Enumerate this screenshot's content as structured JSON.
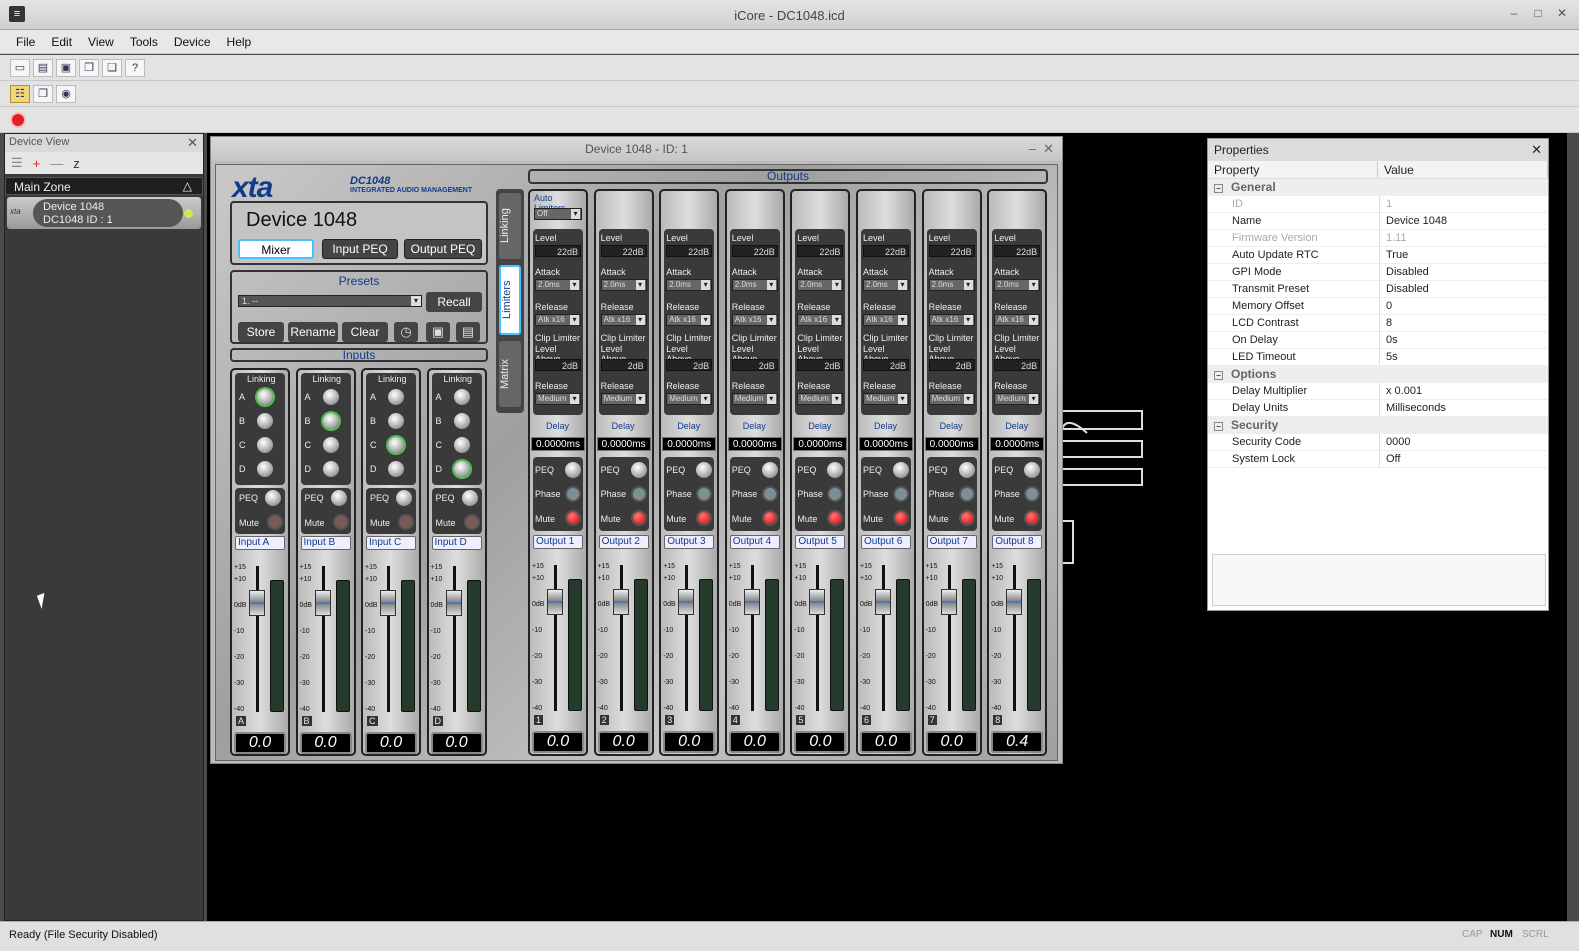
{
  "window": {
    "title": "iCore - DC1048.icd",
    "min": "‒",
    "max": "□",
    "close": "✕"
  },
  "menu": [
    "File",
    "Edit",
    "View",
    "Tools",
    "Device",
    "Help"
  ],
  "device_view": {
    "title": "Device View",
    "zone": "Main Zone",
    "device_line1": "Device  1048",
    "device_line2": "DC1048   ID : 1",
    "logo": "xta"
  },
  "device_window": {
    "title": "Device  1048 - ID: 1",
    "logo": "xta",
    "model": "DC1048",
    "subtitle": "INTEGRATED AUDIO MANAGEMENT",
    "device_name": "Device  1048",
    "tabs": [
      "Mixer",
      "Input PEQ",
      "Output PEQ"
    ],
    "presets_title": "Presets",
    "preset_value": "1. --",
    "recall": "Recall",
    "store": "Store",
    "rename": "Rename",
    "clear": "Clear",
    "inputs_title": "Inputs",
    "outputs_title": "Outputs",
    "side_tabs": [
      "Linking",
      "Limiters",
      "Matrix"
    ],
    "labels": {
      "linking": "Linking",
      "peq": "PEQ",
      "mute": "Mute",
      "phase": "Phase",
      "auto_limiters": "Auto Limiters",
      "level": "Level",
      "attack": "Attack",
      "release": "Release",
      "clip1": "Clip Limiter",
      "clip2": "Level Above",
      "delay": "Delay",
      "off": "Off",
      "link_a": "A",
      "link_b": "B",
      "link_c": "C",
      "link_d": "D"
    },
    "scale": [
      "+15",
      "+10",
      "0dB",
      "-10",
      "-20",
      "-30",
      "-40"
    ],
    "inputs": [
      {
        "name": "Input A",
        "chan": "A",
        "lcd": "0.0",
        "active_link": 0
      },
      {
        "name": "Input B",
        "chan": "B",
        "lcd": "0.0",
        "active_link": 1
      },
      {
        "name": "Input C",
        "chan": "C",
        "lcd": "0.0",
        "active_link": 2
      },
      {
        "name": "Input D",
        "chan": "D",
        "lcd": "0.0",
        "active_link": 3
      }
    ],
    "outputs": [
      {
        "name": "Output 1",
        "chan": "1",
        "level": "22dB",
        "attack": "2.0ms",
        "release": "Atk x16",
        "clip": "2dB",
        "release2": "Medium",
        "delay": "0.0000ms",
        "lcd": "0.0"
      },
      {
        "name": "Output 2",
        "chan": "2",
        "level": "22dB",
        "attack": "2.0ms",
        "release": "Atk x16",
        "clip": "2dB",
        "release2": "Medium",
        "delay": "0.0000ms",
        "lcd": "0.0"
      },
      {
        "name": "Output 3",
        "chan": "3",
        "level": "22dB",
        "attack": "2.0ms",
        "release": "Atk x16",
        "clip": "2dB",
        "release2": "Medium",
        "delay": "0.0000ms",
        "lcd": "0.0"
      },
      {
        "name": "Output 4",
        "chan": "4",
        "level": "22dB",
        "attack": "2.0ms",
        "release": "Atk x16",
        "clip": "2dB",
        "release2": "Medium",
        "delay": "0.0000ms",
        "lcd": "0.0"
      },
      {
        "name": "Output 5",
        "chan": "5",
        "level": "22dB",
        "attack": "2.0ms",
        "release": "Atk x16",
        "clip": "2dB",
        "release2": "Medium",
        "delay": "0.0000ms",
        "lcd": "0.0"
      },
      {
        "name": "Output 6",
        "chan": "6",
        "level": "22dB",
        "attack": "2.0ms",
        "release": "Atk x16",
        "clip": "2dB",
        "release2": "Medium",
        "delay": "0.0000ms",
        "lcd": "0.0"
      },
      {
        "name": "Output 7",
        "chan": "7",
        "level": "22dB",
        "attack": "2.0ms",
        "release": "Atk x16",
        "clip": "2dB",
        "release2": "Medium",
        "delay": "0.0000ms",
        "lcd": "0.0"
      },
      {
        "name": "Output 8",
        "chan": "8",
        "level": "22dB",
        "attack": "2.0ms",
        "release": "Atk x16",
        "clip": "2dB",
        "release2": "Medium",
        "delay": "0.0000ms",
        "lcd": "0.4"
      }
    ]
  },
  "properties": {
    "title": "Properties",
    "col_property": "Property",
    "col_value": "Value",
    "groups": [
      {
        "name": "General",
        "rows": [
          {
            "k": "ID",
            "v": "1",
            "disabled": true
          },
          {
            "k": "Name",
            "v": "Device  1048"
          },
          {
            "k": "Firmware Version",
            "v": "1.11",
            "disabled": true
          },
          {
            "k": "Auto Update RTC",
            "v": "True"
          },
          {
            "k": "GPI Mode",
            "v": "Disabled"
          },
          {
            "k": "Transmit Preset",
            "v": "Disabled"
          },
          {
            "k": "Memory Offset",
            "v": "0"
          },
          {
            "k": "LCD Contrast",
            "v": "8"
          },
          {
            "k": "On Delay",
            "v": "0s"
          },
          {
            "k": "LED Timeout",
            "v": "5s"
          }
        ]
      },
      {
        "name": "Options",
        "rows": [
          {
            "k": "Delay Multiplier",
            "v": "x 0.001"
          },
          {
            "k": "Delay Units",
            "v": "Milliseconds"
          }
        ]
      },
      {
        "name": "Security",
        "rows": [
          {
            "k": "Security Code",
            "v": "0000"
          },
          {
            "k": "System Lock",
            "v": "Off"
          }
        ]
      }
    ]
  },
  "status": {
    "text": "Ready (File Security Disabled)",
    "cap": "CAP",
    "num": "NUM",
    "scrl": "SCRL"
  }
}
